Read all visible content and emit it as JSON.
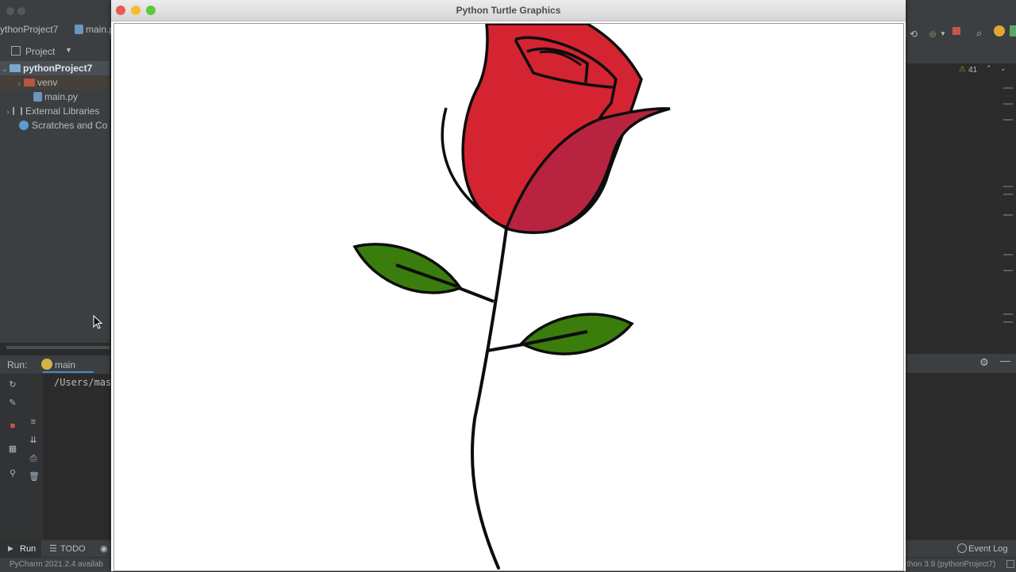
{
  "ide": {
    "project_crumb": "ythonProject7",
    "file_crumb": "main.p",
    "project_tool_label": "Project",
    "tree": [
      {
        "label": "pythonProject7",
        "kind": "folder"
      },
      {
        "label": "venv",
        "kind": "folder"
      },
      {
        "label": "main.py",
        "kind": "file"
      },
      {
        "label": "External Libraries",
        "kind": "lib"
      },
      {
        "label": "Scratches and Co",
        "kind": "scratch"
      }
    ],
    "run_label": "Run:",
    "run_tab": "main",
    "console_line": "/Users/mas",
    "warnings_count": "41",
    "bottom_tabs": {
      "run": "Run",
      "todo": "TODO",
      "event_log": "Event Log"
    },
    "status_left": "PyCharm 2021.2.4 availab",
    "status_right": "thon 3.9 (pythonProject7)"
  },
  "turtle_window": {
    "title": "Python Turtle Graphics"
  },
  "colors": {
    "petal_red": "#d42331",
    "petal_crimson": "#b8243f",
    "leaf_green": "#3a7d0c",
    "outline": "#0d0d0d",
    "close": "#ee5a52",
    "minimize": "#f5bd2e",
    "zoom": "#5fc641"
  }
}
